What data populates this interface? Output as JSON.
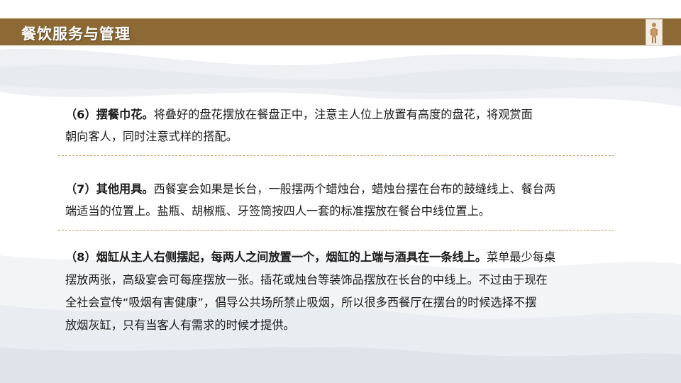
{
  "header": {
    "title": "餐饮服务与管理"
  },
  "sections": [
    {
      "lines": [
        {
          "bold": "（6）摆餐巾花。",
          "normal": "将叠好的盘花摆放在餐盘正中，注意主人位上放置有高度的盘花，将观赏面"
        },
        {
          "bold": "",
          "normal": "朝向客人，同时注意式样的搭配。"
        }
      ]
    },
    {
      "lines": [
        {
          "bold": "（7）其他用具。",
          "normal": "西餐宴会如果是长台，一般摆两个蜡烛台，蜡烛台摆在台布的鼓缝线上、餐台两"
        },
        {
          "bold": "",
          "normal": "端适当的位置上。盐瓶、胡椒瓶、牙签筒按四人一套的标准摆放在餐台中线位置上。"
        }
      ]
    },
    {
      "lines": [
        {
          "bold": "（8）烟缸从主人右侧摆起，每两人之间放置一个，烟缸的上端与酒具在一条线上。",
          "normal": "菜单最少每桌"
        },
        {
          "bold": "",
          "normal": "摆放两张，高级宴会可每座摆放一张。插花或烛台等装饰品摆放在长台的中线上。不过由于现在"
        },
        {
          "bold": "",
          "normal": "全社会宣传“吸烟有害健康”，倡导公共场所禁止吸烟，所以很多西餐厅在摆台的时候选择不摆"
        },
        {
          "bold": "",
          "normal": "放烟灰缸，只有当客人有需求的时候才提供。"
        }
      ]
    }
  ]
}
